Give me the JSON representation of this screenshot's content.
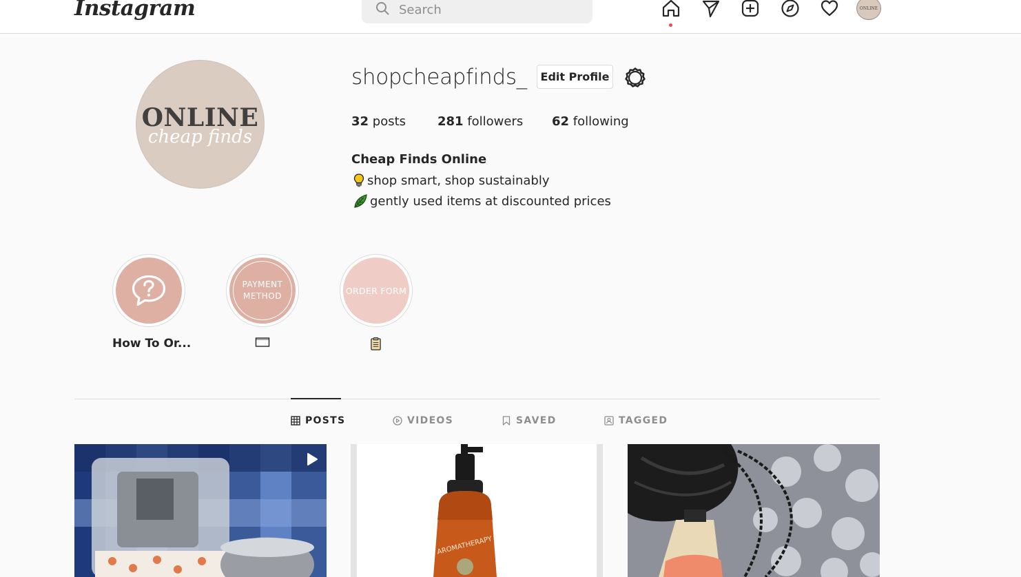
{
  "nav": {
    "logo": "Instagram",
    "search_placeholder": "Search",
    "avatar_text": "ONLINE"
  },
  "profile": {
    "pic_main": "ONLINE",
    "pic_script": "cheap finds",
    "username": "shopcheapfinds_",
    "edit_label": "Edit Profile",
    "stats": {
      "posts_count": "32",
      "posts_label": "posts",
      "followers_count": "281",
      "followers_label": "followers",
      "following_count": "62",
      "following_label": "following"
    },
    "bio_name": "Cheap Finds Online",
    "bio_line1": "shop smart, shop sustainably",
    "bio_line2": "gently used items at discounted prices"
  },
  "highlights": [
    {
      "label": "How To Or...",
      "color": "#deafa3"
    },
    {
      "label": "",
      "cover_text_1": "PAYMENT",
      "cover_text_2": "METHOD",
      "color": "#deafa3"
    },
    {
      "label": "",
      "cover_text": "ORDER FORM",
      "color": "#efcdc6"
    }
  ],
  "tabs": [
    {
      "label": "POSTS",
      "active": true,
      "icon": "grid-icon"
    },
    {
      "label": "VIDEOS",
      "active": false,
      "icon": "play-circle-icon"
    },
    {
      "label": "SAVED",
      "active": false,
      "icon": "bookmark-icon"
    },
    {
      "label": "TAGGED",
      "active": false,
      "icon": "tagged-icon"
    }
  ],
  "colors": {
    "active_tab": "#262626",
    "inactive_tab": "#8e8e8e",
    "notification_dot": "#ed4956",
    "profile_pic_bg": "#dbccc1"
  }
}
